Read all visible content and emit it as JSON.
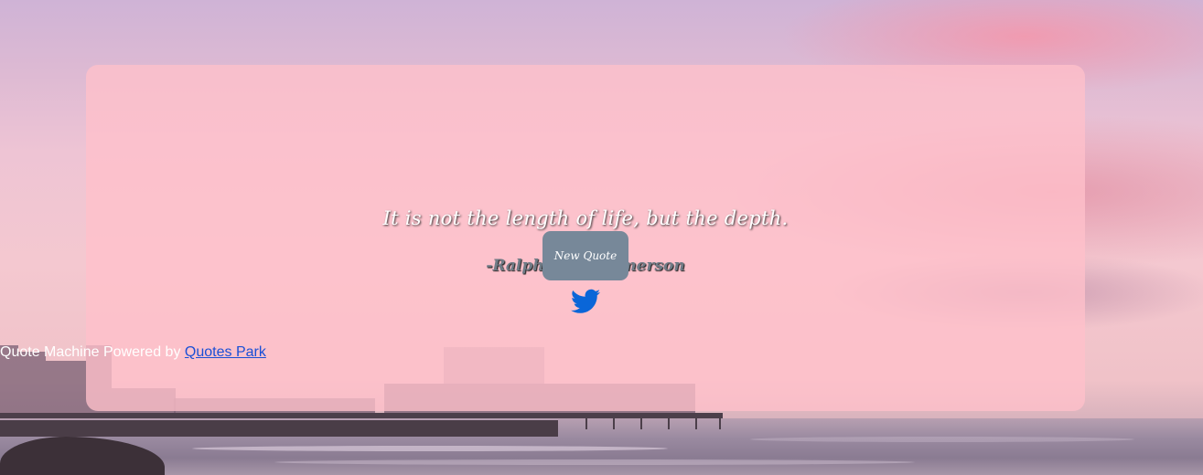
{
  "quote": {
    "text": "It is not the length of life, but the depth.",
    "author": "-Ralph Waldo Emerson"
  },
  "actions": {
    "new_quote_label": "New Quote",
    "tweet_icon": "twitter-bird-icon"
  },
  "footer": {
    "prefix": "Quote Machine Powered by",
    "link_text": "Quotes Park"
  },
  "colors": {
    "card_background": "#ffc0cb",
    "button_background": "#778899",
    "twitter_blue": "#0a66d8",
    "link_blue": "#1a4fd6"
  }
}
